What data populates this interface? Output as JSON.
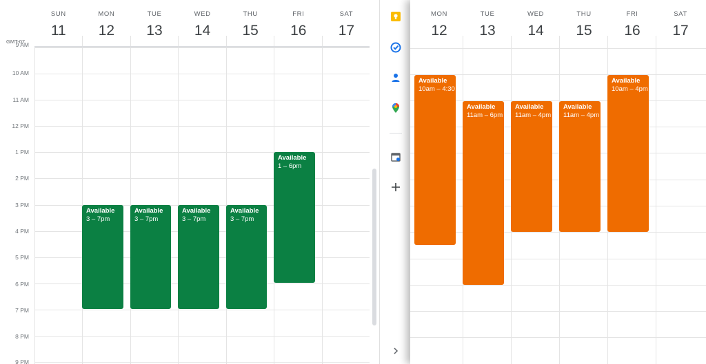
{
  "left_calendar": {
    "timezone": "GMT-07",
    "days": [
      {
        "dow": "SUN",
        "date": "11"
      },
      {
        "dow": "MON",
        "date": "12"
      },
      {
        "dow": "TUE",
        "date": "13"
      },
      {
        "dow": "WED",
        "date": "14"
      },
      {
        "dow": "THU",
        "date": "15"
      },
      {
        "dow": "FRI",
        "date": "16"
      },
      {
        "dow": "SAT",
        "date": "17"
      }
    ],
    "hours": [
      "9 AM",
      "10 AM",
      "11 AM",
      "12 PM",
      "1 PM",
      "2 PM",
      "3 PM",
      "4 PM",
      "5 PM",
      "6 PM",
      "7 PM",
      "8 PM",
      "9 PM"
    ],
    "events": [
      {
        "title": "Available",
        "time": "3 – 7pm"
      },
      {
        "title": "Available",
        "time": "3 – 7pm"
      },
      {
        "title": "Available",
        "time": "3 – 7pm"
      },
      {
        "title": "Available",
        "time": "3 – 7pm"
      },
      {
        "title": "Available",
        "time": "1 – 6pm"
      }
    ],
    "event_color": "#0b8043"
  },
  "side_panel": {
    "icons": [
      "keep-icon",
      "tasks-icon",
      "contacts-icon",
      "maps-icon",
      "calendar-addon-icon",
      "add-icon",
      "expand-chevron-icon"
    ]
  },
  "right_calendar": {
    "days": [
      {
        "dow": "MON",
        "date": "12"
      },
      {
        "dow": "TUE",
        "date": "13"
      },
      {
        "dow": "WED",
        "date": "14"
      },
      {
        "dow": "THU",
        "date": "15"
      },
      {
        "dow": "FRI",
        "date": "16"
      },
      {
        "dow": "SAT",
        "date": "17"
      }
    ],
    "events": [
      {
        "title": "Available",
        "time": "10am – 4:30"
      },
      {
        "title": "Available",
        "time": "11am – 6pm"
      },
      {
        "title": "Available",
        "time": "11am – 4pm"
      },
      {
        "title": "Available",
        "time": "11am – 4pm"
      },
      {
        "title": "Available",
        "time": "10am – 4pm"
      }
    ],
    "event_color": "#ef6c00"
  }
}
